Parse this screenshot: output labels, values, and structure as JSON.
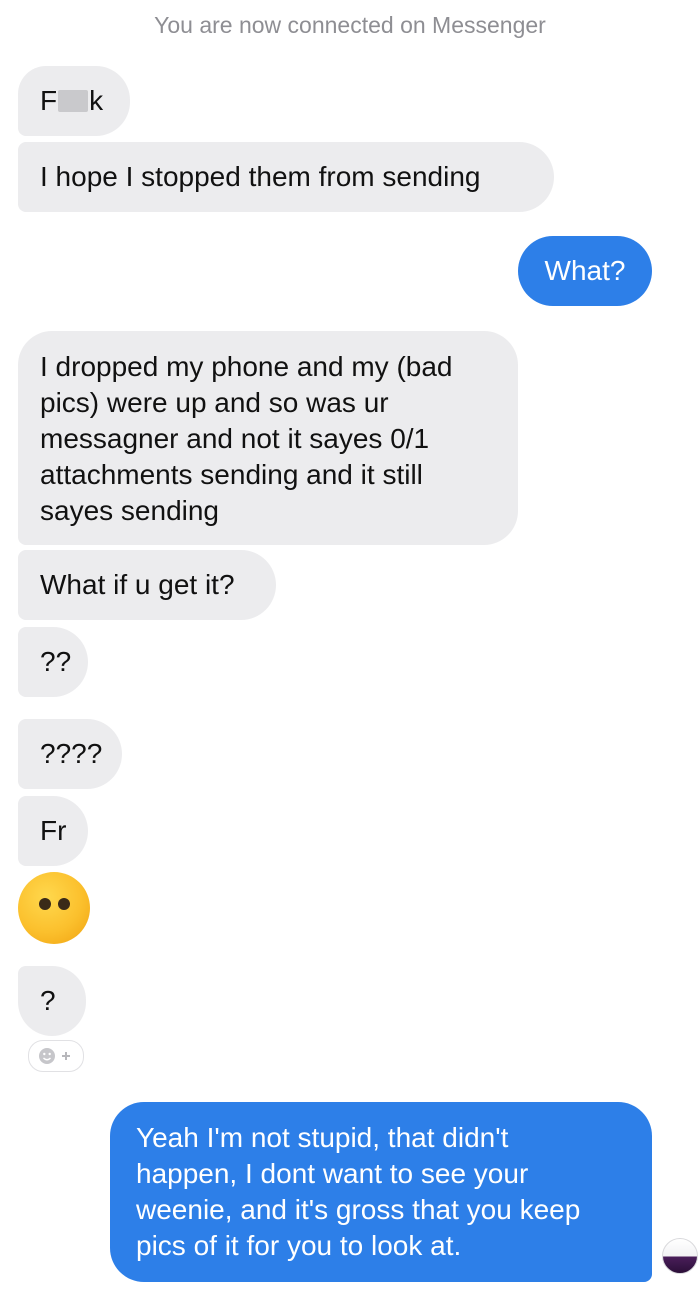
{
  "system_note": "You are now connected on Messenger",
  "messages": [
    {
      "from": "them",
      "text_prefix": "F",
      "text_suffix": "k"
    },
    {
      "from": "them",
      "text": "I hope I stopped them from sending"
    },
    {
      "from": "me",
      "text": "What?"
    },
    {
      "from": "them",
      "lines": [
        "I dropped my phone and my (bad",
        "pics) were up and so was ur",
        "messagner and not it sayes  0/1",
        "attachments sending and it still",
        "sayes sending"
      ]
    },
    {
      "from": "them",
      "text": "What if u get it?"
    },
    {
      "from": "them",
      "text": "??"
    },
    {
      "from": "them",
      "text": "????"
    },
    {
      "from": "them",
      "text": "Fr"
    },
    {
      "from": "them",
      "emoji": "face-without-mouth-emoji"
    },
    {
      "from": "them",
      "text": "?"
    },
    {
      "from": "me",
      "lines": [
        "Yeah I'm not stupid, that didn't",
        "happen, I dont want to see your",
        "weenie, and it's gross that you keep",
        "pics of it for you to look at."
      ]
    }
  ],
  "icons": {
    "reaction": "add-reaction-icon",
    "read_receipt": "read-receipt-avatar"
  },
  "colors": {
    "incoming_bubble": "#ececee",
    "outgoing_bubble": "#2d7fe8",
    "system_text": "#8e8e93"
  }
}
